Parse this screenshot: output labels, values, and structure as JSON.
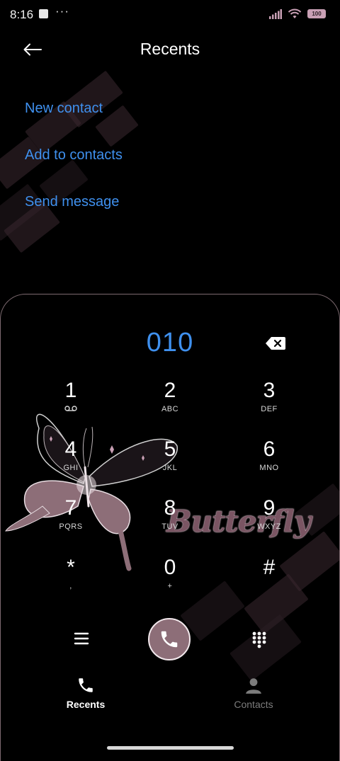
{
  "status_bar": {
    "time": "8:16",
    "overflow": "···",
    "battery": "100",
    "icons": [
      "signal-icon",
      "wifi-icon",
      "battery-icon"
    ]
  },
  "header": {
    "title": "Recents",
    "back_icon": "back-arrow-icon"
  },
  "menu": {
    "new_contact": "New contact",
    "add_to_contacts": "Add to contacts",
    "send_message": "Send message"
  },
  "dialer": {
    "number": "010",
    "keys": [
      {
        "digit": "1",
        "letters": ""
      },
      {
        "digit": "2",
        "letters": "ABC"
      },
      {
        "digit": "3",
        "letters": "DEF"
      },
      {
        "digit": "4",
        "letters": "GHI"
      },
      {
        "digit": "5",
        "letters": "JKL"
      },
      {
        "digit": "6",
        "letters": "MNO"
      },
      {
        "digit": "7",
        "letters": "PQRS"
      },
      {
        "digit": "8",
        "letters": "TUV"
      },
      {
        "digit": "9",
        "letters": "WXYZ"
      },
      {
        "digit": "*",
        "letters": ","
      },
      {
        "digit": "0",
        "letters": "+"
      },
      {
        "digit": "#",
        "letters": ""
      }
    ]
  },
  "theme": {
    "wallpaper_text": "Butterfly",
    "accent": "#3f90ee",
    "call_button": "#8d6e78"
  },
  "bottom_nav": {
    "recents": "Recents",
    "contacts": "Contacts"
  }
}
